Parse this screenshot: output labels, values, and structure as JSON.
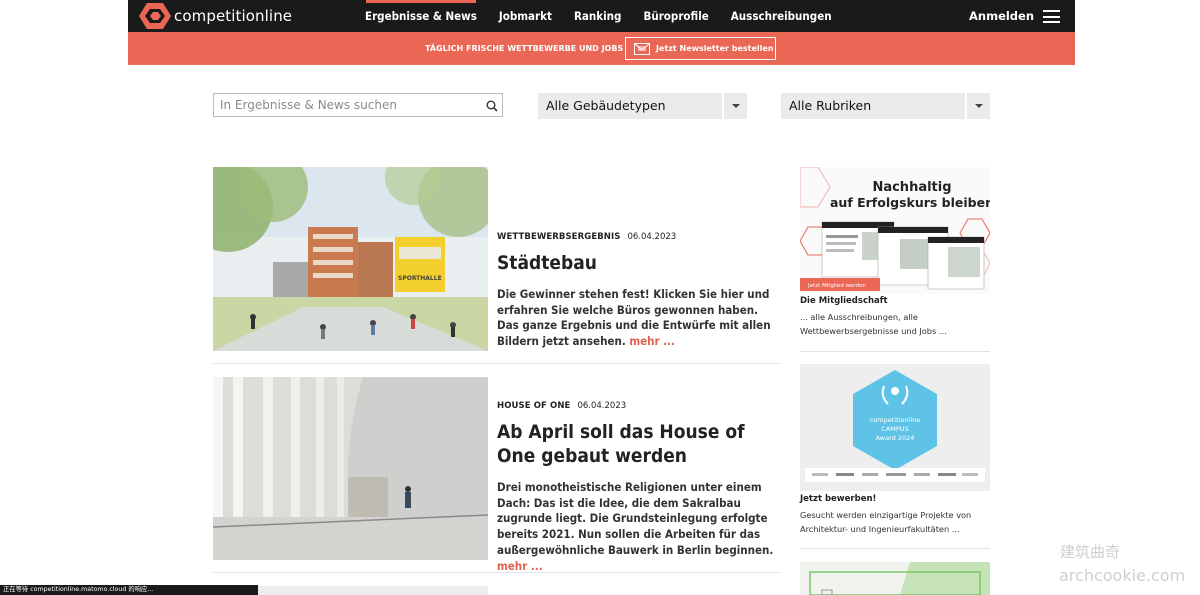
{
  "header": {
    "logo_text": "competitionline",
    "nav": [
      {
        "label": "Ergebnisse & News",
        "active": true
      },
      {
        "label": "Jobmarkt",
        "active": false
      },
      {
        "label": "Ranking",
        "active": false
      },
      {
        "label": "Büroprofile",
        "active": false
      },
      {
        "label": "Ausschreibungen",
        "active": false
      }
    ],
    "login_label": "Anmelden"
  },
  "banner": {
    "text": "TÄGLICH FRISCHE WETTBEWERBE UND JOBS",
    "button_label": "Jetzt Newsletter bestellen"
  },
  "filters": {
    "search_placeholder": "In Ergebnisse & News suchen",
    "building_types": "Alle Gebäudetypen",
    "categories": "Alle Rubriken"
  },
  "articles": [
    {
      "category": "WETTBEWERBSERGEBNIS",
      "date": "06.04.2023",
      "title": "Städtebau",
      "teaser": "Die Gewinner stehen fest! Klicken Sie hier und erfahren Sie welche Büros gewonnen haben. Das ganze Ergebnis und die Entwürfe mit allen Bildern jetzt ansehen.",
      "more": "mehr ...",
      "image_sign": "SPORTHALLE"
    },
    {
      "category": "HOUSE OF ONE",
      "date": "06.04.2023",
      "title": "Ab April soll das House of One gebaut werden",
      "teaser": "Drei monotheistische Religionen unter einem Dach: Das ist die Idee, die dem Sakralbau zugrunde liegt. Die Grundsteinlegung erfolgte bereits 2021. Nun sollen die Arbeiten für das außergewöhnliche Bauwerk in Berlin beginnen.",
      "more": "mehr ..."
    }
  ],
  "sidebar": {
    "membership": {
      "headline_1": "Nachhaltig",
      "headline_2": "auf Erfolgskurs bleiben",
      "cta": "Jetzt Mitglied werden",
      "title": "Die Mitgliedschaft",
      "text": "... alle Ausschreibungen, alle Wettbewerbsergebnisse und Jobs ..."
    },
    "award": {
      "badge_1": "competitionline",
      "badge_2": "CAMPUS",
      "badge_3": "Award 2024",
      "title": "Jetzt bewerben!",
      "text": "Gesucht werden einzigartige Projekte von Architektur- und Ingenieurfakultäten ..."
    }
  },
  "status_bar": "正在等待 competitionline.matomo.cloud 的响应...",
  "watermark": {
    "line1": "建筑曲奇",
    "line2": "archcookie.com"
  },
  "colors": {
    "accent": "#ea6756",
    "header_bg": "#1a1a1a",
    "link": "#e0604f",
    "badge": "#5ec3e6"
  }
}
